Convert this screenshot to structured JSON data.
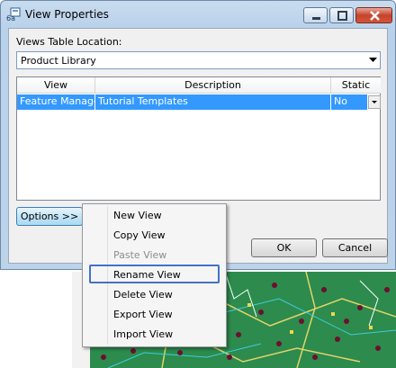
{
  "window": {
    "title": "View Properties"
  },
  "views_table_location": {
    "label": "Views Table Location:",
    "selected": "Product Library"
  },
  "table": {
    "headers": [
      "View",
      "Description",
      "Static"
    ],
    "rows": [
      {
        "view": "Feature Manager",
        "description": "Tutorial Templates",
        "static": "No"
      }
    ]
  },
  "buttons": {
    "options": "Options >>",
    "ok": "OK",
    "cancel": "Cancel"
  },
  "context_menu": {
    "items": [
      {
        "label": "New View",
        "enabled": true
      },
      {
        "label": "Copy View",
        "enabled": true
      },
      {
        "label": "Paste View",
        "enabled": false
      },
      {
        "label": "Rename View",
        "enabled": true,
        "highlighted": true
      },
      {
        "label": "Delete View",
        "enabled": true
      },
      {
        "label": "Export View",
        "enabled": true
      },
      {
        "label": "Import View",
        "enabled": true
      }
    ]
  },
  "colors": {
    "selection": "#3399ff",
    "menu_highlight": "#4472c4",
    "title_gradient": "#b9d1ea"
  }
}
